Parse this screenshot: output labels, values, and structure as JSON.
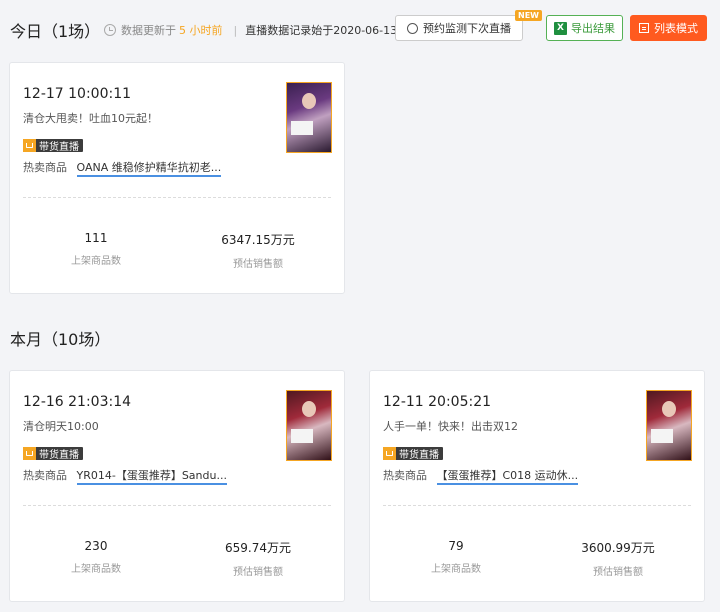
{
  "today": {
    "title": "今日（1场）",
    "info_prefix": "数据更新于",
    "info_highlight": "5 小时前",
    "info_sep": "|",
    "info_record": "直播数据记录始于2020-06-13"
  },
  "toolbar": {
    "reserve_label": "预约监测下次直播",
    "new_badge": "NEW",
    "export_icon": "X",
    "export_label": "导出结果",
    "list_label": "列表模式"
  },
  "month": {
    "title": "本月（10场）"
  },
  "cards": [
    {
      "time": "12-17 10:00:11",
      "subtitle": "清仓大甩卖！吐血10元起！",
      "tag": "带货直播",
      "hot_label": "热卖商品",
      "product": "OANA 维稳修护精华抗初老...",
      "goods_count": "111",
      "goods_label": "上架商品数",
      "sales": "6347.15万元",
      "sales_label": "预估销售额"
    },
    {
      "time": "12-16 21:03:14",
      "subtitle": "清仓明天10:00",
      "tag": "带货直播",
      "hot_label": "热卖商品",
      "product": "YR014-【蛋蛋推荐】Sandu...",
      "goods_count": "230",
      "goods_label": "上架商品数",
      "sales": "659.74万元",
      "sales_label": "预估销售额"
    },
    {
      "time": "12-11 20:05:21",
      "subtitle": "人手一单！快来！出击双12",
      "tag": "带货直播",
      "hot_label": "热卖商品",
      "product": "【蛋蛋推荐】C018 运动休...",
      "goods_count": "79",
      "goods_label": "上架商品数",
      "sales": "3600.99万元",
      "sales_label": "预估销售额"
    }
  ]
}
